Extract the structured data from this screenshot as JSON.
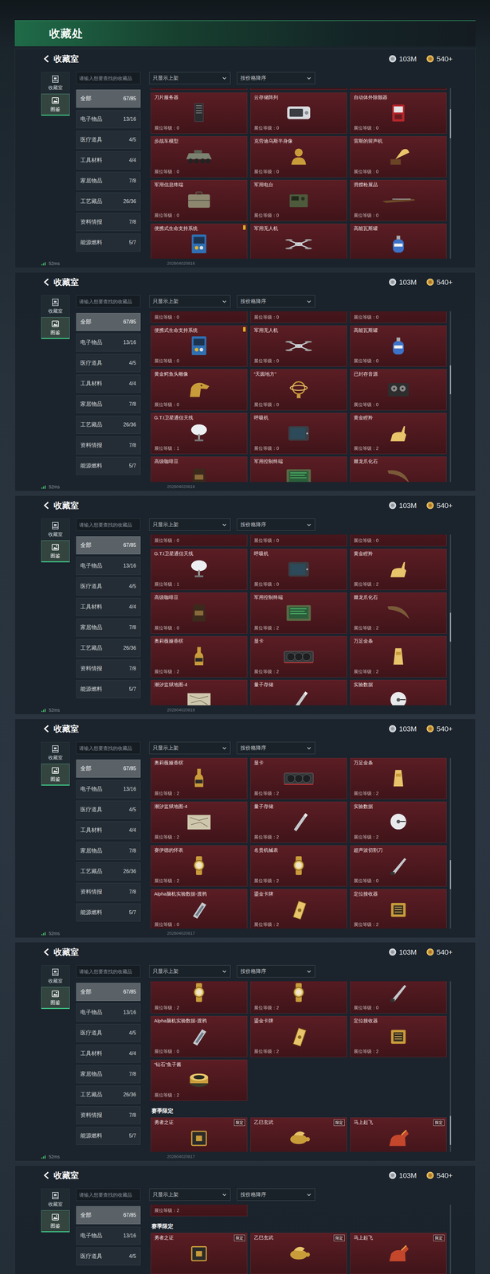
{
  "page": {
    "title": "收藏处"
  },
  "panels": [
    {
      "header": {
        "title": "收藏室",
        "silver": "103M",
        "gold": "540+"
      },
      "tabs": [
        {
          "label": "收藏室",
          "selected": false
        },
        {
          "label": "图鉴",
          "selected": true
        }
      ],
      "search": {
        "placeholder": "请输入想要查找的收藏品"
      },
      "categories": [
        {
          "label": "全部",
          "count": "67/85",
          "selected": true
        },
        {
          "label": "电子物品",
          "count": "13/16",
          "selected": false
        },
        {
          "label": "医疗道具",
          "count": "4/5",
          "selected": false
        },
        {
          "label": "工具材料",
          "count": "4/4",
          "selected": false
        },
        {
          "label": "家居物品",
          "count": "7/8",
          "selected": false
        },
        {
          "label": "工艺藏品",
          "count": "26/36",
          "selected": false
        },
        {
          "label": "资料情报",
          "count": "7/8",
          "selected": false
        },
        {
          "label": "能源燃料",
          "count": "5/7",
          "selected": false
        }
      ],
      "filters": [
        "只显示上架",
        "按价格降序"
      ],
      "scroll": {
        "level": 0.15
      },
      "grid": [
        {
          "kind": "row",
          "cells": [
            {
              "flagged": false
            },
            {
              "flagged": false
            },
            {
              "flagged": false
            }
          ]
        },
        {
          "kind": "row",
          "cells": [
            {
              "name": "刀片服务器",
              "level": "展位等级：0",
              "flagged": false
            },
            {
              "name": "云存储阵列",
              "level": "展位等级：0",
              "flagged": false
            },
            {
              "name": "自动体外除颤器",
              "level": "展位等级：0",
              "flagged": false
            }
          ]
        },
        {
          "kind": "row",
          "cells": [
            {
              "name": "步战车模型",
              "level": "展位等级：0",
              "flagged": false
            },
            {
              "name": "克劳迪乌斯半身像",
              "level": "展位等级：0",
              "flagged": false
            },
            {
              "name": "雷斯的留声机",
              "level": "展位等级：0",
              "flagged": false
            }
          ]
        },
        {
          "kind": "row",
          "cells": [
            {
              "name": "军用信息终端",
              "level": "展位等级：0",
              "flagged": false
            },
            {
              "name": "军用电台",
              "level": "展位等级：0",
              "flagged": false
            },
            {
              "name": "滑膛枪展品",
              "level": "展位等级：0",
              "flagged": false
            }
          ]
        },
        {
          "kind": "row",
          "cells": [
            {
              "name": "便携式生命支持系统",
              "flagged": true
            },
            {
              "name": "军用无人机",
              "flagged": false
            },
            {
              "name": "高能瓦斯罐",
              "flagged": false
            }
          ]
        }
      ],
      "footer": {
        "ping": "52ms",
        "code": "202604020816"
      }
    },
    {
      "header": {
        "title": "收藏室",
        "silver": "103M",
        "gold": "540+"
      },
      "tabs": [
        {
          "label": "收藏室",
          "selected": false
        },
        {
          "label": "图鉴",
          "selected": true
        }
      ],
      "search": {
        "placeholder": "请输入想要查找的收藏品"
      },
      "categories": [
        {
          "label": "全部",
          "count": "67/85",
          "selected": true
        },
        {
          "label": "电子物品",
          "count": "13/16",
          "selected": false
        },
        {
          "label": "医疗道具",
          "count": "4/5",
          "selected": false
        },
        {
          "label": "工具材料",
          "count": "4/4",
          "selected": false
        },
        {
          "label": "家居物品",
          "count": "7/8",
          "selected": false
        },
        {
          "label": "工艺藏品",
          "count": "26/36",
          "selected": false
        },
        {
          "label": "资料情报",
          "count": "7/8",
          "selected": false
        },
        {
          "label": "能源燃料",
          "count": "5/7",
          "selected": false
        }
      ],
      "filters": [
        "只显示上架",
        "按价格降序"
      ],
      "scroll": {
        "level": 0.38
      },
      "grid": [
        {
          "kind": "row",
          "cells": [
            {
              "level": "展位等级：0",
              "flagged": false
            },
            {
              "level": "展位等级：0",
              "flagged": false
            },
            {
              "level": "展位等级：0",
              "flagged": false
            }
          ]
        },
        {
          "kind": "row",
          "cells": [
            {
              "name": "便携式生命支持系统",
              "level": "展位等级：0",
              "flagged": true
            },
            {
              "name": "军用无人机",
              "level": "展位等级：0",
              "flagged": false
            },
            {
              "name": "高能瓦斯罐",
              "level": "展位等级：0",
              "flagged": false
            }
          ]
        },
        {
          "kind": "row",
          "cells": [
            {
              "name": "黄金鳄鱼头雕像",
              "level": "展位等级：0",
              "flagged": false
            },
            {
              "name": "“天圆地方”",
              "level": "展位等级：0",
              "flagged": false
            },
            {
              "name": "已封存音源",
              "level": "展位等级：0",
              "flagged": false
            }
          ]
        },
        {
          "kind": "row",
          "cells": [
            {
              "name": "G.T.I卫星通信天线",
              "level": "展位等级：1",
              "flagged": false
            },
            {
              "name": "呼吸机",
              "level": "展位等级：0",
              "flagged": false
            },
            {
              "name": "黄金瞪羚",
              "level": "展位等级：2",
              "flagged": false
            }
          ]
        },
        {
          "kind": "row",
          "cells": [
            {
              "name": "高级咖啡豆",
              "flagged": false
            },
            {
              "name": "军用控制终端",
              "flagged": false
            },
            {
              "name": "棘龙爪化石",
              "flagged": false
            }
          ]
        }
      ],
      "footer": {
        "ping": "52ms",
        "code": "202604020816"
      }
    },
    {
      "header": {
        "title": "收藏室",
        "silver": "103M",
        "gold": "540+"
      },
      "tabs": [
        {
          "label": "收藏室",
          "selected": false
        },
        {
          "label": "图鉴",
          "selected": true
        }
      ],
      "search": {
        "placeholder": "请输入想要查找的收藏品"
      },
      "categories": [
        {
          "label": "全部",
          "count": "67/85",
          "selected": true
        },
        {
          "label": "电子物品",
          "count": "13/16",
          "selected": false
        },
        {
          "label": "医疗道具",
          "count": "4/5",
          "selected": false
        },
        {
          "label": "工具材料",
          "count": "4/4",
          "selected": false
        },
        {
          "label": "家居物品",
          "count": "7/8",
          "selected": false
        },
        {
          "label": "工艺藏品",
          "count": "26/36",
          "selected": false
        },
        {
          "label": "资料情报",
          "count": "7/8",
          "selected": false
        },
        {
          "label": "能源燃料",
          "count": "5/7",
          "selected": false
        }
      ],
      "filters": [
        "只显示上架",
        "按价格降序"
      ],
      "scroll": {
        "level": 0.55
      },
      "grid": [
        {
          "kind": "row",
          "cells": [
            {
              "level": "展位等级：0",
              "flagged": false
            },
            {
              "level": "展位等级：0",
              "flagged": false
            },
            {
              "level": "展位等级：0",
              "flagged": false
            }
          ]
        },
        {
          "kind": "row",
          "cells": [
            {
              "name": "G.T.I卫星通信天线",
              "level": "展位等级：1",
              "flagged": false
            },
            {
              "name": "呼吸机",
              "level": "展位等级：0",
              "flagged": false
            },
            {
              "name": "黄金瞪羚",
              "level": "展位等级：2",
              "flagged": false
            }
          ]
        },
        {
          "kind": "row",
          "cells": [
            {
              "name": "高级咖啡豆",
              "level": "展位等级：0",
              "flagged": false
            },
            {
              "name": "军用控制终端",
              "level": "展位等级：2",
              "flagged": false
            },
            {
              "name": "棘龙爪化石",
              "level": "展位等级：2",
              "flagged": false
            }
          ]
        },
        {
          "kind": "row",
          "cells": [
            {
              "name": "奥莉薇娅香槟",
              "level": "展位等级：2",
              "flagged": false
            },
            {
              "name": "显卡",
              "level": "展位等级：2",
              "flagged": false
            },
            {
              "name": "万足金条",
              "level": "展位等级：2",
              "flagged": false
            }
          ]
        },
        {
          "kind": "row",
          "cells": [
            {
              "name": "潮汐监狱地图-4",
              "flagged": false
            },
            {
              "name": "量子存储",
              "flagged": false
            },
            {
              "name": "实验数据",
              "flagged": false
            }
          ]
        }
      ],
      "footer": {
        "ping": "52ms",
        "code": "202604020816"
      }
    },
    {
      "header": {
        "title": "收藏室",
        "silver": "103M",
        "gold": "540+"
      },
      "tabs": [
        {
          "label": "收藏室",
          "selected": false
        },
        {
          "label": "图鉴",
          "selected": true
        }
      ],
      "search": {
        "placeholder": "请输入想要查找的收藏品"
      },
      "categories": [
        {
          "label": "全部",
          "count": "67/85",
          "selected": true
        },
        {
          "label": "电子物品",
          "count": "13/16",
          "selected": false
        },
        {
          "label": "医疗道具",
          "count": "4/5",
          "selected": false
        },
        {
          "label": "工具材料",
          "count": "4/4",
          "selected": false
        },
        {
          "label": "家居物品",
          "count": "7/8",
          "selected": false
        },
        {
          "label": "工艺藏品",
          "count": "26/36",
          "selected": false
        },
        {
          "label": "资料情报",
          "count": "7/8",
          "selected": false
        },
        {
          "label": "能源燃料",
          "count": "5/7",
          "selected": false
        }
      ],
      "filters": [
        "只显示上架",
        "按价格降序"
      ],
      "scroll": {
        "level": 0.72
      },
      "grid": [
        {
          "kind": "row",
          "cells": [
            {
              "name": "奥莉薇娅香槟",
              "level": "展位等级：2",
              "flagged": false
            },
            {
              "name": "显卡",
              "level": "展位等级：2",
              "flagged": false
            },
            {
              "name": "万足金条",
              "level": "展位等级：2",
              "flagged": false
            }
          ]
        },
        {
          "kind": "row",
          "cells": [
            {
              "name": "潮汐监狱地图-4",
              "level": "展位等级：2",
              "flagged": false
            },
            {
              "name": "量子存储",
              "level": "展位等级：2",
              "flagged": false
            },
            {
              "name": "实验数据",
              "level": "展位等级：2",
              "flagged": false
            }
          ]
        },
        {
          "kind": "row",
          "cells": [
            {
              "name": "赛伊德的怀表",
              "level": "展位等级：2",
              "flagged": false
            },
            {
              "name": "名贵机械表",
              "level": "展位等级：2",
              "flagged": false
            },
            {
              "name": "超声波切割刀",
              "level": "展位等级：0",
              "flagged": false
            }
          ]
        },
        {
          "kind": "row",
          "cells": [
            {
              "name": "Alpha脑机实验数据-渡鸦",
              "level": "展位等级：0",
              "flagged": false
            },
            {
              "name": "鎏金卡牌",
              "level": "展位等级：2",
              "flagged": false
            },
            {
              "name": "定位接收器",
              "level": "展位等级：2",
              "flagged": false
            }
          ]
        }
      ],
      "footer": {
        "ping": "52ms",
        "code": "202604020817"
      }
    },
    {
      "header": {
        "title": "收藏室",
        "silver": "103M",
        "gold": "540+"
      },
      "tabs": [
        {
          "label": "收藏室",
          "selected": false
        },
        {
          "label": "图鉴",
          "selected": true
        }
      ],
      "search": {
        "placeholder": "请输入想要查找的收藏品"
      },
      "categories": [
        {
          "label": "全部",
          "count": "67/85",
          "selected": true
        },
        {
          "label": "电子物品",
          "count": "13/16",
          "selected": false
        },
        {
          "label": "医疗道具",
          "count": "4/5",
          "selected": false
        },
        {
          "label": "工具材料",
          "count": "4/4",
          "selected": false
        },
        {
          "label": "家居物品",
          "count": "7/8",
          "selected": false
        },
        {
          "label": "工艺藏品",
          "count": "26/36",
          "selected": false
        },
        {
          "label": "资料情报",
          "count": "7/8",
          "selected": false
        },
        {
          "label": "能源燃料",
          "count": "5/7",
          "selected": false
        }
      ],
      "filters": [
        "只显示上架",
        "按价格降序"
      ],
      "scroll": {
        "level": 0.95
      },
      "grid": [
        {
          "kind": "row",
          "cells": [
            {
              "level": "展位等级：2",
              "flagged": false
            },
            {
              "level": "展位等级：2",
              "flagged": false
            },
            {
              "level": "展位等级：0",
              "flagged": false
            }
          ]
        },
        {
          "kind": "row",
          "cells": [
            {
              "name": "Alpha脑机实验数据-渡鸦",
              "level": "展位等级：0",
              "flagged": false
            },
            {
              "name": "鎏金卡牌",
              "level": "展位等级：2",
              "flagged": false
            },
            {
              "name": "定位接收器",
              "level": "展位等级：2",
              "flagged": false
            }
          ]
        },
        {
          "kind": "row",
          "cells": [
            {
              "name": "“钻石”鱼子酱",
              "level": "展位等级：2",
              "flagged": false
            }
          ]
        },
        {
          "kind": "section",
          "title": "赛季限定"
        },
        {
          "kind": "row",
          "cells": [
            {
              "name": "勇者之证",
              "badge": "限定",
              "flagged": false
            },
            {
              "name": "乙巳玄武",
              "badge": "限定",
              "flagged": false
            },
            {
              "name": "马上起飞",
              "badge": "限定",
              "flagged": false
            }
          ]
        }
      ],
      "footer": {
        "ping": "52ms",
        "code": "202604020817"
      }
    },
    {
      "header": {
        "title": "收藏室",
        "silver": "103M",
        "gold": "540+"
      },
      "tabs": [
        {
          "label": "收藏室",
          "selected": false
        },
        {
          "label": "图鉴",
          "selected": true
        }
      ],
      "search": {
        "placeholder": "请输入想要查找的收藏品"
      },
      "categories": [
        {
          "label": "全部",
          "count": "67/85",
          "selected": true
        },
        {
          "label": "电子物品",
          "count": "13/16",
          "selected": false
        },
        {
          "label": "医疗道具",
          "count": "4/5",
          "selected": false
        }
      ],
      "filters": [
        "只显示上架",
        "按价格降序"
      ],
      "scroll": {
        "level": 1.0
      },
      "grid": [
        {
          "kind": "row",
          "cells": [
            {
              "level": "展位等级：2",
              "flagged": false
            }
          ]
        },
        {
          "kind": "section",
          "title": "赛季限定"
        },
        {
          "kind": "row",
          "cells": [
            {
              "name": "勇者之证",
              "badge": "限定",
              "flagged": false
            },
            {
              "name": "乙巳玄武",
              "badge": "限定",
              "flagged": false
            },
            {
              "name": "马上起飞",
              "badge": "限定",
              "flagged": false
            }
          ]
        }
      ]
    }
  ]
}
